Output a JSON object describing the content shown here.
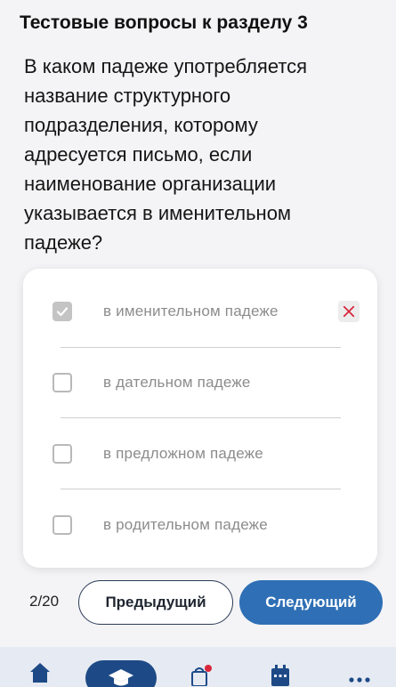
{
  "header": {
    "title": "Тестовые вопросы к разделу 3"
  },
  "question": {
    "text": "В каком падеже употребляется название структурного подразделения, которому адресуется письмо,  если наименование организации указывается в именительном падеже?"
  },
  "options": [
    {
      "label": "в именительном падеже",
      "checked": true,
      "wrong": true
    },
    {
      "label": "в дательном падеже",
      "checked": false,
      "wrong": false
    },
    {
      "label": "в предложном падеже",
      "checked": false,
      "wrong": false
    },
    {
      "label": "в родительном падеже",
      "checked": false,
      "wrong": false
    }
  ],
  "footer": {
    "counter": "2/20",
    "prev_label": "Предыдущий",
    "next_label": "Следующий"
  },
  "nav": {
    "items": [
      "home-icon",
      "graduation-cap-icon",
      "shopping-bag-icon",
      "calendar-icon",
      "more-icon"
    ],
    "active_index": 1
  },
  "colors": {
    "accent": "#2f6fb5",
    "nav_active": "#1d4a86",
    "wrong_mark": "#d8263a",
    "badge": "#d8263a"
  }
}
